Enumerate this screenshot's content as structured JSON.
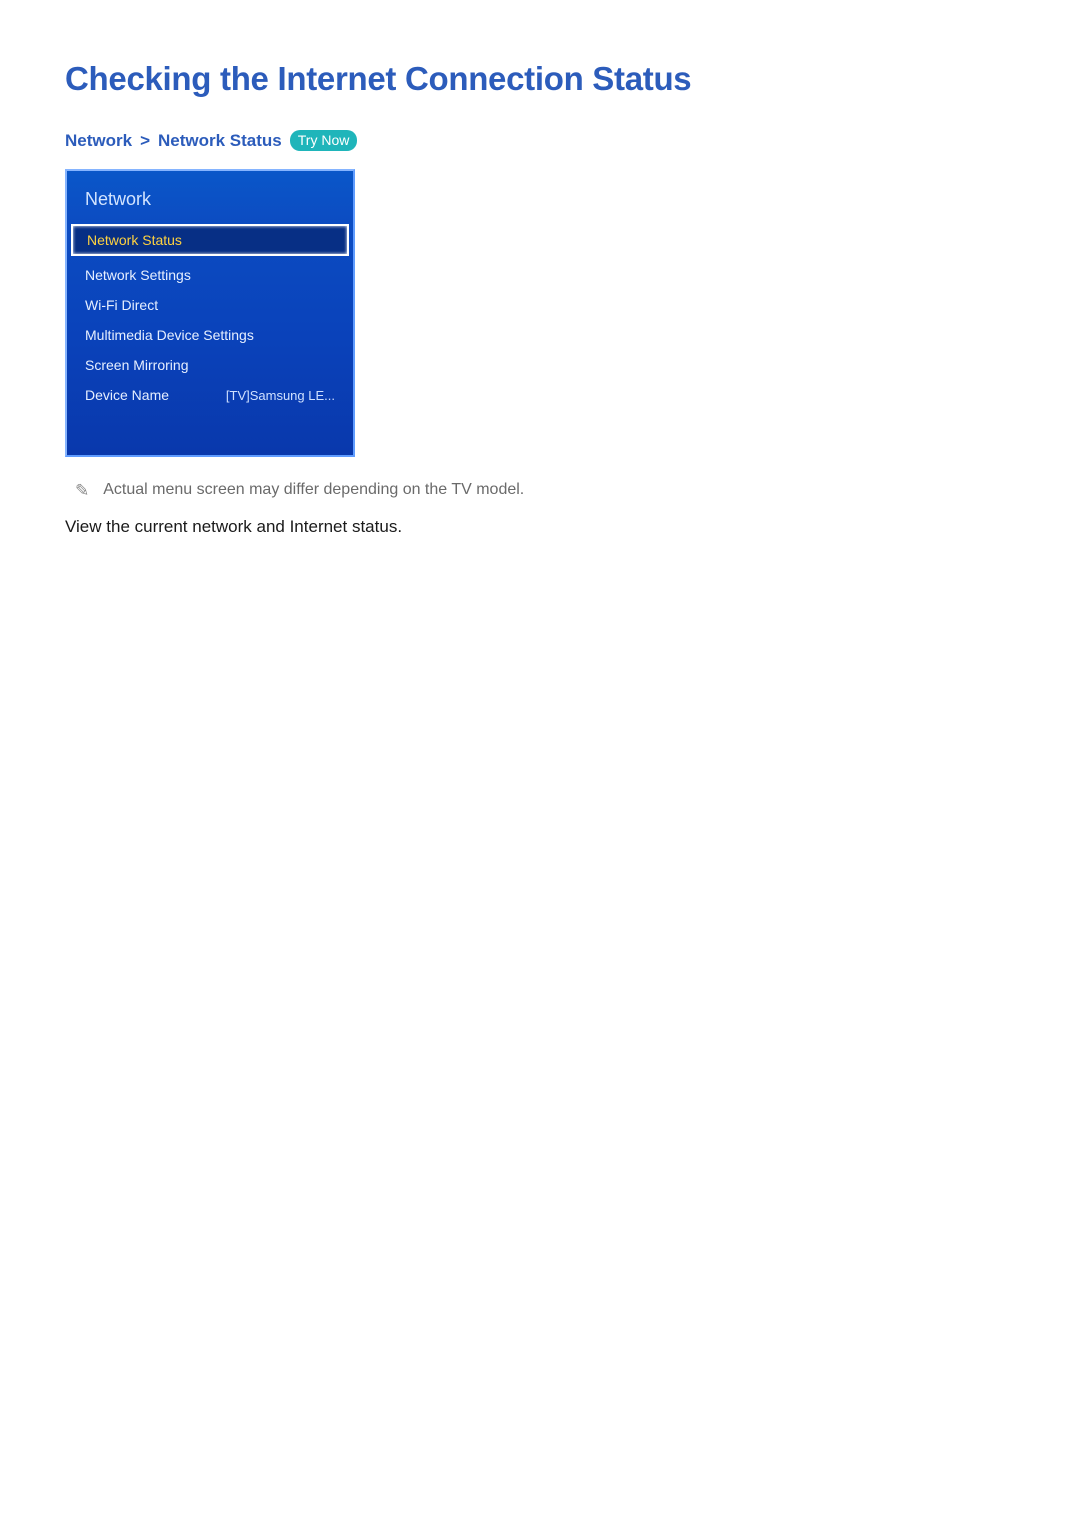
{
  "title": "Checking the Internet Connection Status",
  "breadcrumb": {
    "part1": "Network",
    "sep": ">",
    "part2": "Network Status",
    "badge": "Try Now"
  },
  "menu": {
    "header": "Network",
    "items": [
      {
        "label": "Network Status",
        "value": "",
        "selected": true
      },
      {
        "label": "Network Settings",
        "value": "",
        "selected": false
      },
      {
        "label": "Wi-Fi Direct",
        "value": "",
        "selected": false
      },
      {
        "label": "Multimedia Device Settings",
        "value": "",
        "selected": false
      },
      {
        "label": "Screen Mirroring",
        "value": "",
        "selected": false
      },
      {
        "label": "Device Name",
        "value": "[TV]Samsung LE...",
        "selected": false
      }
    ]
  },
  "note": "Actual menu screen may differ depending on the TV model.",
  "body": "View the current network and Internet status."
}
